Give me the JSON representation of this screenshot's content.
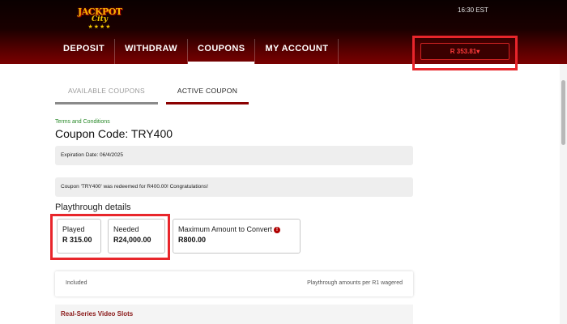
{
  "header": {
    "logo": {
      "line1": "JACKPOT",
      "line2": "City",
      "stars": "★★★★"
    },
    "time": "16:30 EST",
    "nav": [
      {
        "label": "DEPOSIT"
      },
      {
        "label": "WITHDRAW"
      },
      {
        "label": "COUPONS"
      },
      {
        "label": "MY ACCOUNT"
      }
    ],
    "active_nav": "COUPONS",
    "balance": "R 353.81",
    "balance_caret": "▾"
  },
  "tabs": {
    "available": "AVAILABLE COUPONS",
    "active": "ACTIVE COUPON"
  },
  "coupon": {
    "terms_link": "Terms and Conditions",
    "code_line": "Coupon Code: TRY400",
    "expiration": "Expiration Date: 06/4/2025",
    "message": "Coupon 'TRY400' was redeemed for R400.00! Congratulations!"
  },
  "playthrough": {
    "heading": "Playthrough details",
    "played": {
      "label": "Played",
      "value": "R 315.00"
    },
    "needed": {
      "label": "Needed",
      "value": "R24,000.00"
    },
    "max_convert": {
      "label": "Maximum Amount to Convert",
      "value": "R800.00",
      "info_icon": "!"
    }
  },
  "included": {
    "left": "Included",
    "right": "Playthrough amounts per R1 wagered"
  },
  "series": {
    "title": "Real-Series Video Slots"
  },
  "colors": {
    "header_dark": "#0a0000",
    "header_red": "#7a0000",
    "accent_red": "#8b0000",
    "highlight": "#e8262b",
    "terms_green": "#2a8a2a",
    "balance_text": "#ff3a3a"
  }
}
